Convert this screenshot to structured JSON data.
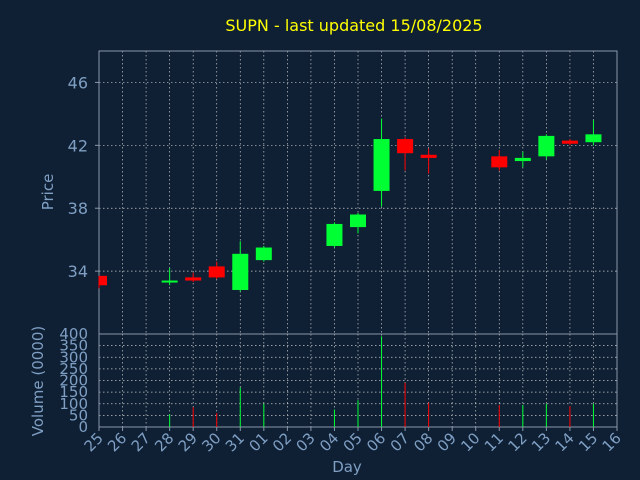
{
  "chart_data": {
    "type": "candlestick",
    "title": "SUPN - last updated 15/08/2025",
    "xlabel": "Day",
    "ylabel": "Price",
    "volume_label": "Volume (0000)",
    "ylim": [
      30,
      48
    ],
    "volume_ylim": [
      0,
      400
    ],
    "price_ticks": [
      34,
      38,
      42,
      46
    ],
    "volume_ticks": [
      0,
      50,
      100,
      150,
      200,
      250,
      300,
      350,
      400
    ],
    "grid": true,
    "x_ticks": [
      "25",
      "26",
      "27",
      "28",
      "29",
      "30",
      "31",
      "01",
      "02",
      "03",
      "04",
      "05",
      "06",
      "07",
      "08",
      "09",
      "10",
      "11",
      "12",
      "13",
      "14",
      "15",
      "16"
    ],
    "candles": [
      {
        "day": "25",
        "open": 33.7,
        "high": 33.7,
        "low": 32.9,
        "close": 33.1,
        "volume": 0
      },
      {
        "day": "28",
        "open": 33.3,
        "high": 34.2,
        "low": 33.1,
        "close": 33.4,
        "volume": 55
      },
      {
        "day": "29",
        "open": 33.6,
        "high": 33.9,
        "low": 33.3,
        "close": 33.4,
        "volume": 85
      },
      {
        "day": "30",
        "open": 34.3,
        "high": 34.6,
        "low": 33.5,
        "close": 33.6,
        "volume": 60
      },
      {
        "day": "31",
        "open": 32.8,
        "high": 35.9,
        "low": 32.7,
        "close": 35.1,
        "volume": 170
      },
      {
        "day": "01",
        "open": 34.7,
        "high": 35.6,
        "low": 34.6,
        "close": 35.5,
        "volume": 100
      },
      {
        "day": "04",
        "open": 35.6,
        "high": 37.1,
        "low": 35.5,
        "close": 37.0,
        "volume": 75
      },
      {
        "day": "05",
        "open": 36.8,
        "high": 37.7,
        "low": 36.4,
        "close": 37.6,
        "volume": 115
      },
      {
        "day": "06",
        "open": 39.1,
        "high": 43.7,
        "low": 38.1,
        "close": 42.4,
        "volume": 390
      },
      {
        "day": "07",
        "open": 42.4,
        "high": 42.5,
        "low": 40.4,
        "close": 41.5,
        "volume": 190
      },
      {
        "day": "08",
        "open": 41.4,
        "high": 41.8,
        "low": 40.2,
        "close": 41.2,
        "volume": 105
      },
      {
        "day": "11",
        "open": 41.3,
        "high": 41.7,
        "low": 40.4,
        "close": 40.6,
        "volume": 95
      },
      {
        "day": "12",
        "open": 41.0,
        "high": 41.6,
        "low": 40.6,
        "close": 41.2,
        "volume": 95
      },
      {
        "day": "13",
        "open": 41.3,
        "high": 42.7,
        "low": 41.1,
        "close": 42.6,
        "volume": 100
      },
      {
        "day": "14",
        "open": 42.3,
        "high": 42.4,
        "low": 42.0,
        "close": 42.1,
        "volume": 90
      },
      {
        "day": "15",
        "open": 42.2,
        "high": 43.6,
        "low": 42.0,
        "close": 42.7,
        "volume": 100
      }
    ],
    "colors": {
      "background": "#0f2035",
      "up": "#00ff33",
      "down": "#ff0000",
      "frame": "#8898a8",
      "grid": "#c8c8c8",
      "title": "#ffff00",
      "axis_text": "#7f9fc3"
    }
  }
}
